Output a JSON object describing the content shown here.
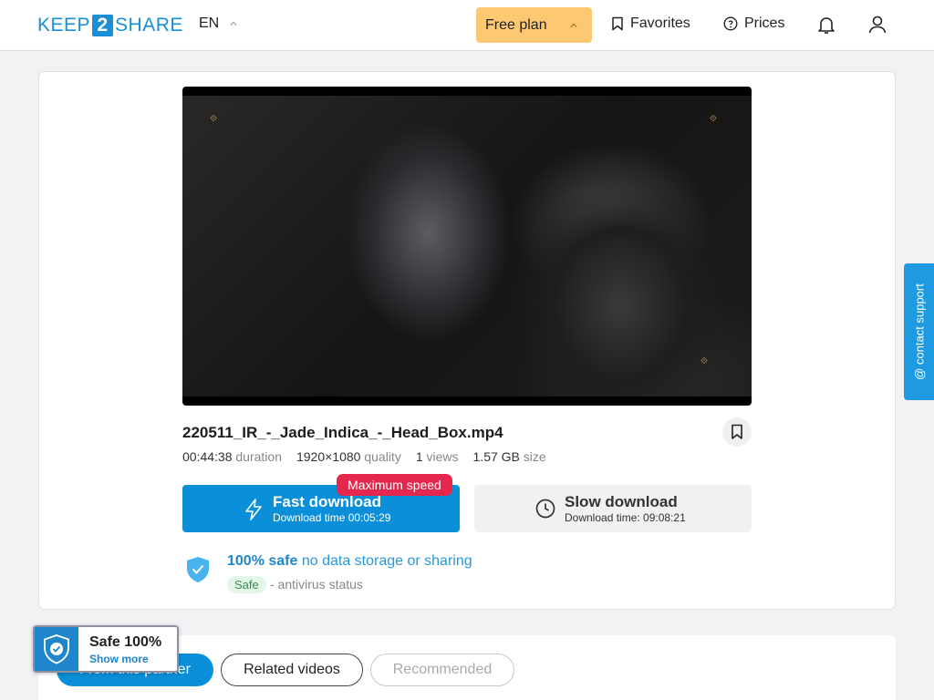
{
  "header": {
    "logo": {
      "left": "KEEP",
      "mid": "2",
      "right": "SHARE"
    },
    "lang": "EN",
    "plan": "Free plan",
    "favorites": "Favorites",
    "prices": "Prices"
  },
  "file": {
    "name": "220511_IR_-_Jade_Indica_-_Head_Box.mp4",
    "duration": "00:44:38",
    "duration_label": "duration",
    "quality": "1920×1080",
    "quality_label": "quality",
    "views": "1",
    "views_label": "views",
    "size": "1.57 GB",
    "size_label": "size"
  },
  "download": {
    "fast_title": "Fast download",
    "fast_time": "Download time 00:05:29",
    "badge": "Maximum speed",
    "slow_title": "Slow download",
    "slow_time": "Download time: 09:08:21"
  },
  "safety": {
    "bold": "100% safe",
    "rest": " no data storage or sharing",
    "tag": "Safe",
    "antivirus": "- antivirus status"
  },
  "tabs": {
    "partner": "From this partner",
    "related": "Related videos",
    "recommended": "Recommended"
  },
  "safe_badge": {
    "title": "Safe 100%",
    "more": "Show more"
  },
  "contact": "@ contact support",
  "colors": {
    "accent": "#0b8fd8",
    "plan": "#fdc872",
    "badge": "#e6274d"
  }
}
